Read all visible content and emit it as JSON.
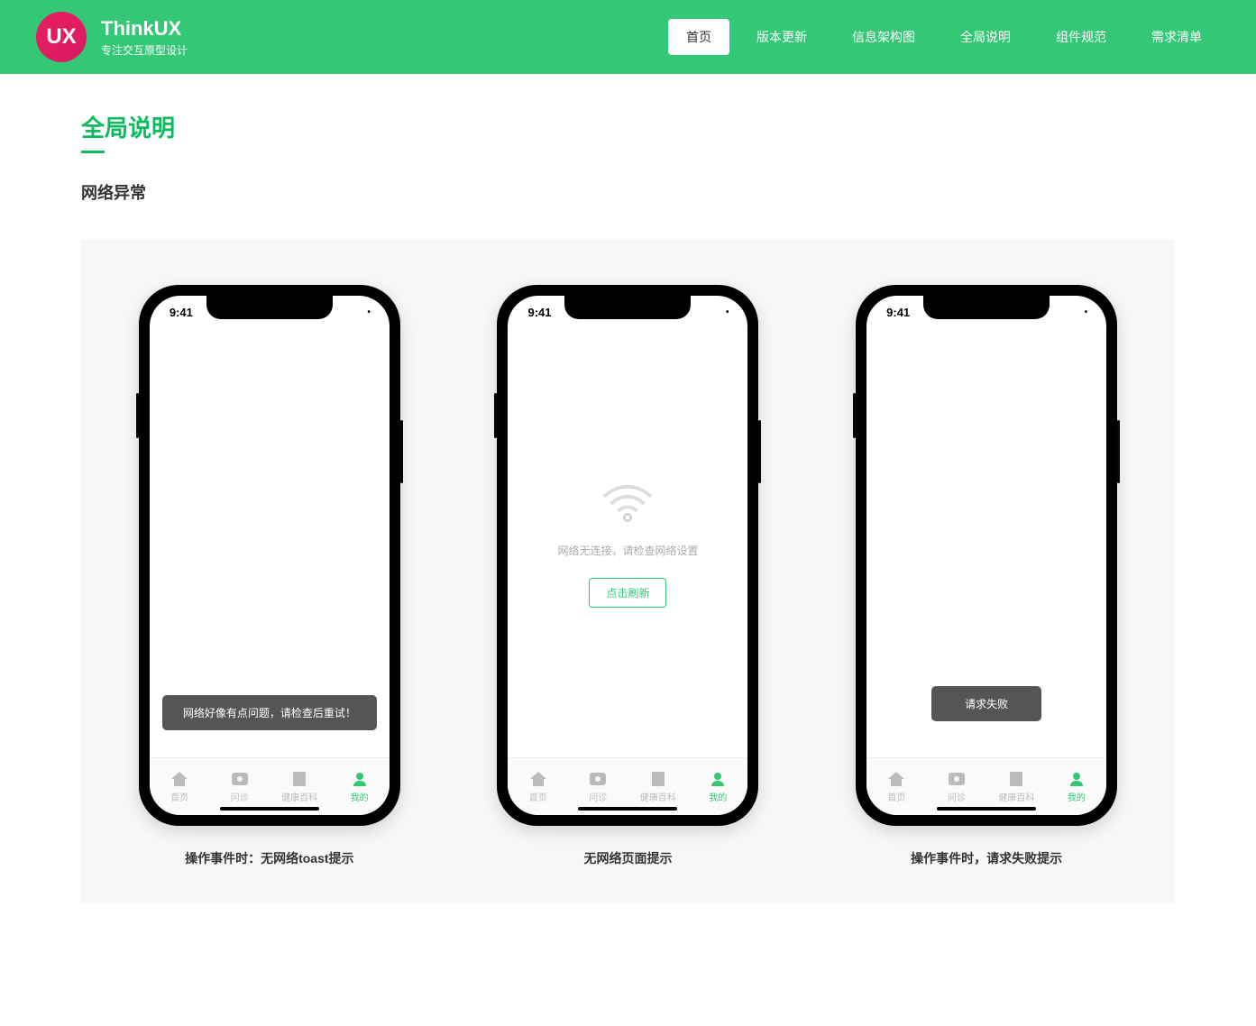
{
  "header": {
    "logo_text": "UX",
    "title": "ThinkUX",
    "subtitle": "专注交互原型设计",
    "nav": [
      {
        "label": "首页",
        "active": true
      },
      {
        "label": "版本更新",
        "active": false
      },
      {
        "label": "信息架构图",
        "active": false
      },
      {
        "label": "全局说明",
        "active": false
      },
      {
        "label": "组件规范",
        "active": false
      },
      {
        "label": "需求清单",
        "active": false
      }
    ]
  },
  "page": {
    "title": "全局说明",
    "section_title": "网络异常"
  },
  "status_bar": {
    "time": "9:41"
  },
  "tabbar": {
    "items": [
      {
        "label": "首页"
      },
      {
        "label": "问诊"
      },
      {
        "label": "健康百科"
      },
      {
        "label": "我的"
      }
    ],
    "active_index": 3
  },
  "mockups": [
    {
      "caption": "操作事件时：无网络toast提示",
      "toast": "网络好像有点问题，请检查后重试！"
    },
    {
      "caption": "无网络页面提示",
      "no_net_text": "网络无连接，请检查网络设置",
      "refresh_label": "点击刷新"
    },
    {
      "caption": "操作事件时，请求失败提示",
      "toast": "请求失败"
    }
  ],
  "colors": {
    "primary": "#34c876",
    "title_green": "#0dbb5e",
    "toast_bg": "#555555"
  }
}
